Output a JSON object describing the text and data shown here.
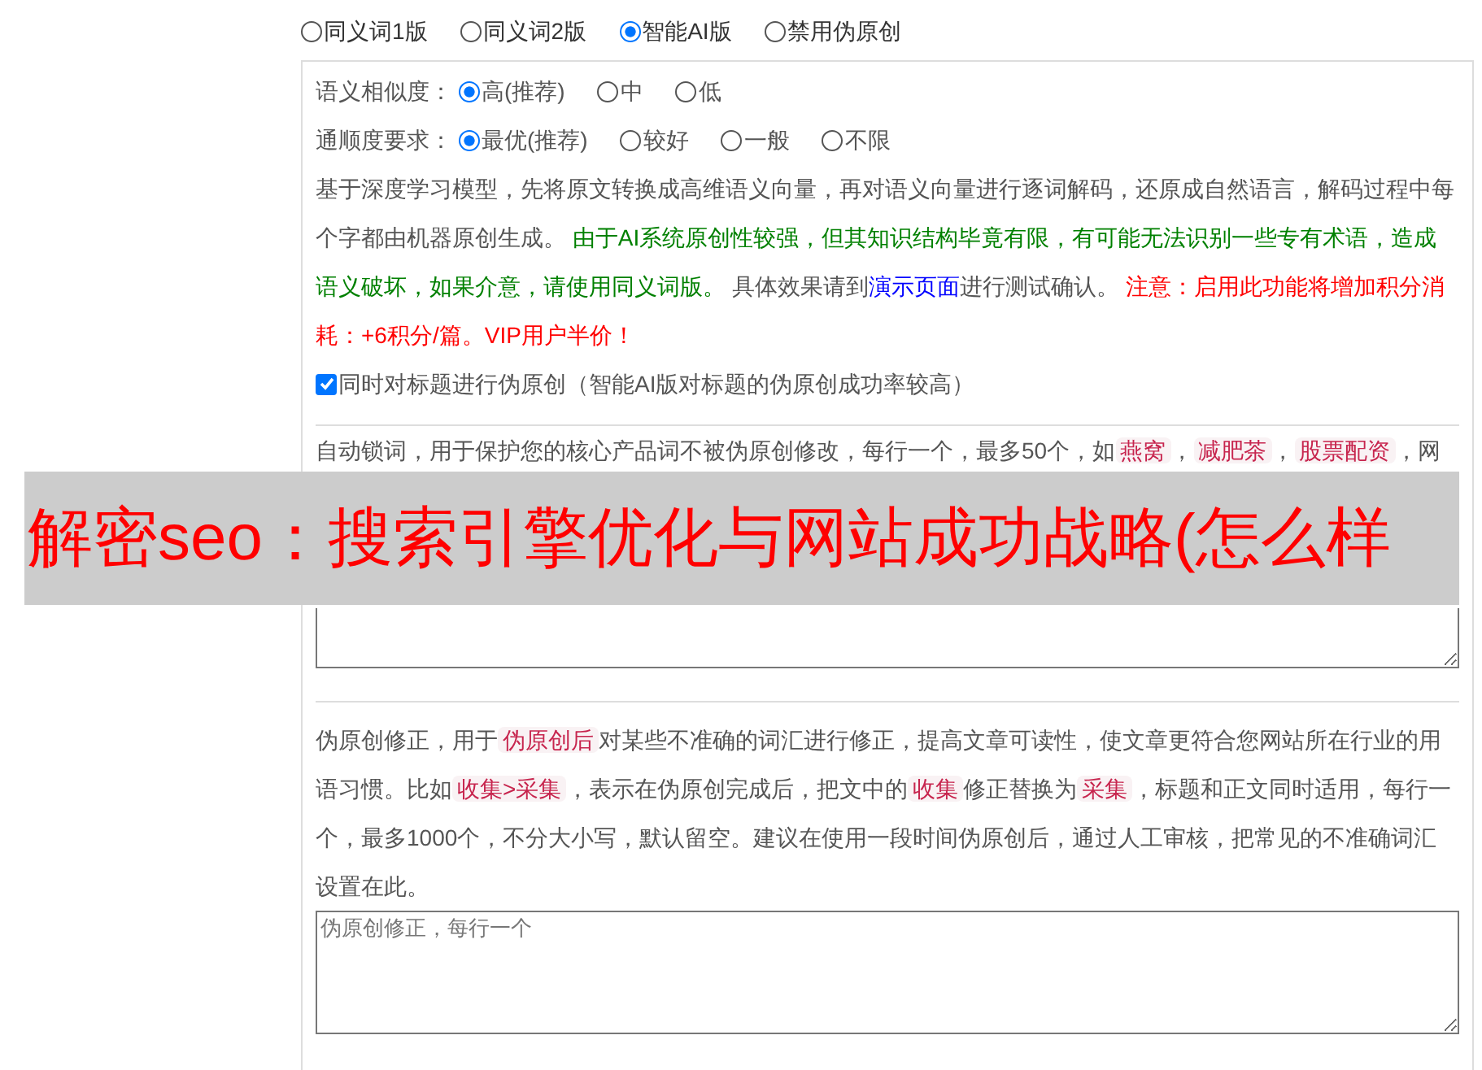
{
  "mode_options": [
    {
      "label": "同义词1版",
      "selected": false
    },
    {
      "label": "同义词2版",
      "selected": false
    },
    {
      "label": "智能AI版",
      "selected": true
    },
    {
      "label": "禁用伪原创",
      "selected": false
    }
  ],
  "similarity": {
    "label": "语义相似度：",
    "options": [
      {
        "label": "高(推荐)",
        "selected": true
      },
      {
        "label": "中",
        "selected": false
      },
      {
        "label": "低",
        "selected": false
      }
    ]
  },
  "fluency": {
    "label": "通顺度要求：",
    "options": [
      {
        "label": "最优(推荐)",
        "selected": true
      },
      {
        "label": "较好",
        "selected": false
      },
      {
        "label": "一般",
        "selected": false
      },
      {
        "label": "不限",
        "selected": false
      }
    ]
  },
  "description": [
    {
      "kind": "plain",
      "text": "基于深度学习模型，先将原文转换成高维语义向量，再对语义向量进行逐词解码，还原成自然语言，解码过程中每个字都由机器原创生成。 "
    },
    {
      "kind": "green",
      "text": "由于AI系统原创性较强，但其知识结构毕竟有限，有可能无法识别一些专有术语，造成语义破坏，如果介意，请使用同义词版。"
    },
    {
      "kind": "plain",
      "text": " 具体效果请到"
    },
    {
      "kind": "link",
      "text": "演示页面"
    },
    {
      "kind": "plain",
      "text": "进行测试确认。 "
    },
    {
      "kind": "red",
      "text": "注意：启用此功能将增加积分消耗：+6积分/篇。VIP用户半价！"
    }
  ],
  "title_option": {
    "label": "同时对标题进行伪原创（智能AI版对标题的伪原创成功率较高）",
    "checked": true
  },
  "lock_words": {
    "segments": [
      {
        "kind": "plain",
        "text": "自动锁词，用于保护您的核心产品词不被伪原创修改，每行一个，最多50个，如"
      },
      {
        "kind": "code",
        "text": "燕窝"
      },
      {
        "kind": "plain",
        "text": "，"
      },
      {
        "kind": "code",
        "text": "减肥茶"
      },
      {
        "kind": "plain",
        "text": "，"
      },
      {
        "kind": "code",
        "text": "股票配资"
      },
      {
        "kind": "plain",
        "text": "，网"
      }
    ]
  },
  "correction": {
    "segments": [
      {
        "kind": "plain",
        "text": "伪原创修正，用于"
      },
      {
        "kind": "code",
        "text": "伪原创后"
      },
      {
        "kind": "plain",
        "text": "对某些不准确的词汇进行修正，提高文章可读性，使文章更符合您网站所在行业的用语习惯。比如"
      },
      {
        "kind": "code",
        "text": "收集>采集"
      },
      {
        "kind": "plain",
        "text": "，表示在伪原创完成后，把文中的"
      },
      {
        "kind": "code",
        "text": "收集"
      },
      {
        "kind": "plain",
        "text": "修正替换为"
      },
      {
        "kind": "code",
        "text": "采集"
      },
      {
        "kind": "plain",
        "text": "，标题和正文同时适用，每行一个，最多1000个，不分大小写，默认留空。建议在使用一段时间伪原创后，通过人工审核，把常见的不准确词汇设置在此。"
      }
    ],
    "placeholder": "伪原创修正，每行一个"
  },
  "banner": {
    "text": "解密seo：搜索引擎优化与网站成功战略(怎么样"
  }
}
